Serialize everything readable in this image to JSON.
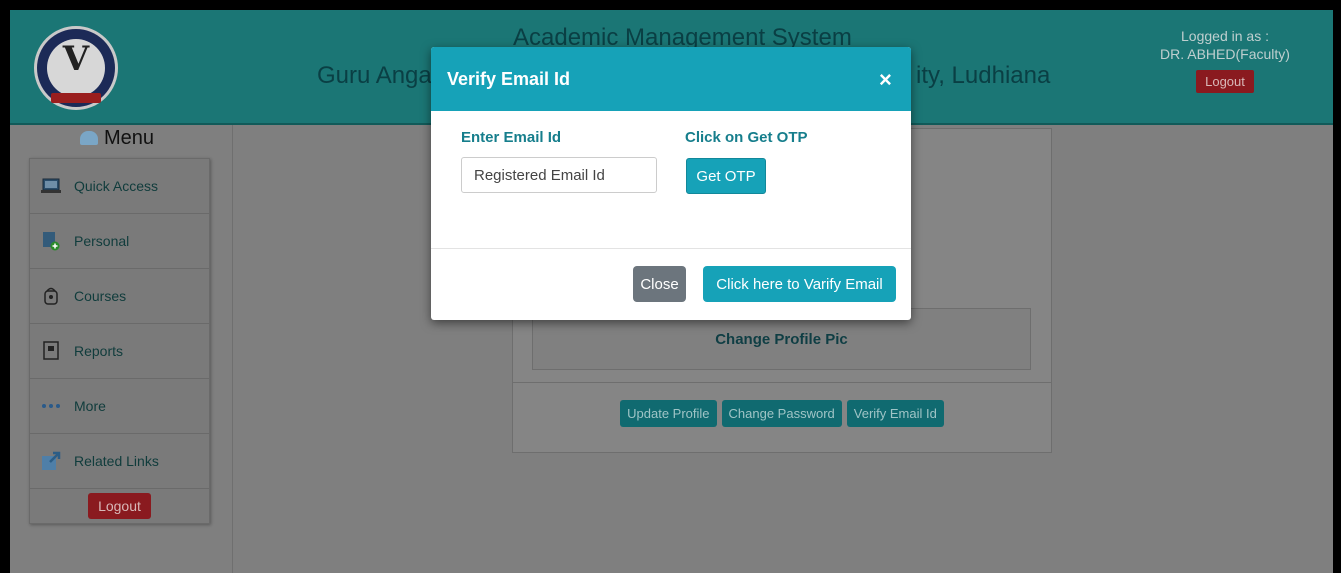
{
  "header": {
    "app_title": "Academic Management System",
    "university_left": "Guru Angad",
    "university_right": "ity, Ludhiana",
    "logged_in_label": "Logged in as :",
    "user_name": "DR. ABHED(Faculty)",
    "logout_label": "Logout"
  },
  "sidebar": {
    "title": "Menu",
    "items": [
      {
        "label": "Quick Access",
        "icon": "laptop-icon"
      },
      {
        "label": "Personal",
        "icon": "document-add-icon"
      },
      {
        "label": "Courses",
        "icon": "book-bag-icon"
      },
      {
        "label": "Reports",
        "icon": "report-icon"
      },
      {
        "label": "More",
        "icon": "ellipsis-icon"
      },
      {
        "label": "Related Links",
        "icon": "external-link-icon"
      }
    ],
    "logout_label": "Logout"
  },
  "profile_panel": {
    "change_pic_label": "Change Profile Pic",
    "buttons": [
      "Update Profile",
      "Change Password",
      "Verify Email Id"
    ]
  },
  "modal": {
    "title": "Verify Email Id",
    "close_symbol": "×",
    "email_label": "Enter Email Id",
    "email_placeholder": "Registered Email Id",
    "otp_label": "Click on Get OTP",
    "otp_button": "Get OTP",
    "close_button": "Close",
    "verify_button": "Click here to Varify Email"
  },
  "colors": {
    "header_bg": "#1b7675",
    "modal_header": "#16a2b8",
    "danger": "#8a1a1f",
    "secondary": "#6c757d"
  }
}
